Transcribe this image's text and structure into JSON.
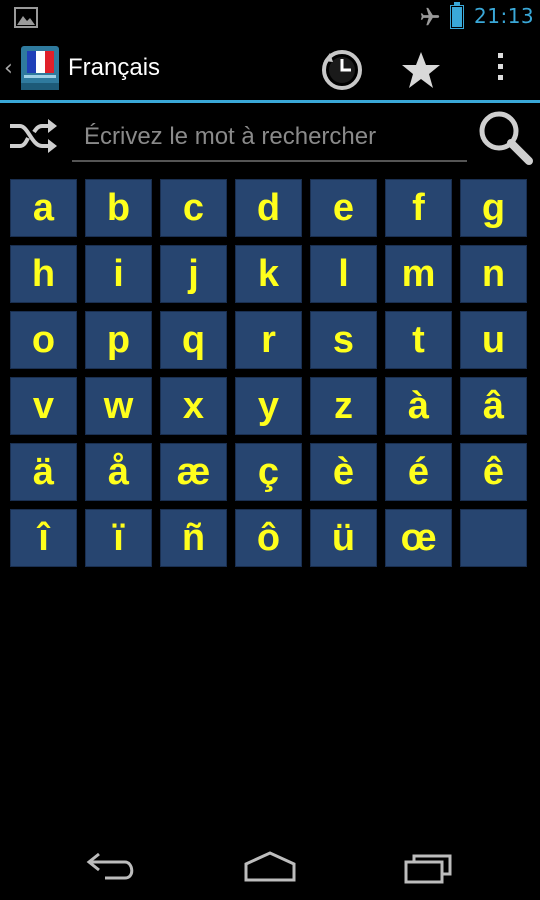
{
  "status_bar": {
    "time": "21:13",
    "icons": [
      "gallery-notification-icon",
      "airplane-mode-icon",
      "battery-icon"
    ],
    "accent_color": "#3aa8d8"
  },
  "action_bar": {
    "title": "Français",
    "app_icon": "french-dictionary-icon",
    "actions": [
      "history-icon",
      "star-icon",
      "overflow-menu-icon"
    ]
  },
  "search": {
    "placeholder": "Écrivez le mot à rechercher",
    "value": "",
    "left_icon": "shuffle-icon",
    "right_icon": "search-icon"
  },
  "letters": {
    "keys": [
      "a",
      "b",
      "c",
      "d",
      "e",
      "f",
      "g",
      "h",
      "i",
      "j",
      "k",
      "l",
      "m",
      "n",
      "o",
      "p",
      "q",
      "r",
      "s",
      "t",
      "u",
      "v",
      "w",
      "x",
      "y",
      "z",
      "à",
      "â",
      "ä",
      "å",
      "æ",
      "ç",
      "è",
      "é",
      "ê",
      "î",
      "ï",
      "ñ",
      "ô",
      "ü",
      "œ",
      ""
    ],
    "key_color": "#274570",
    "text_color": "#ffff1c"
  },
  "nav_bar": {
    "icons": [
      "back-icon",
      "home-icon",
      "recent-apps-icon"
    ]
  }
}
